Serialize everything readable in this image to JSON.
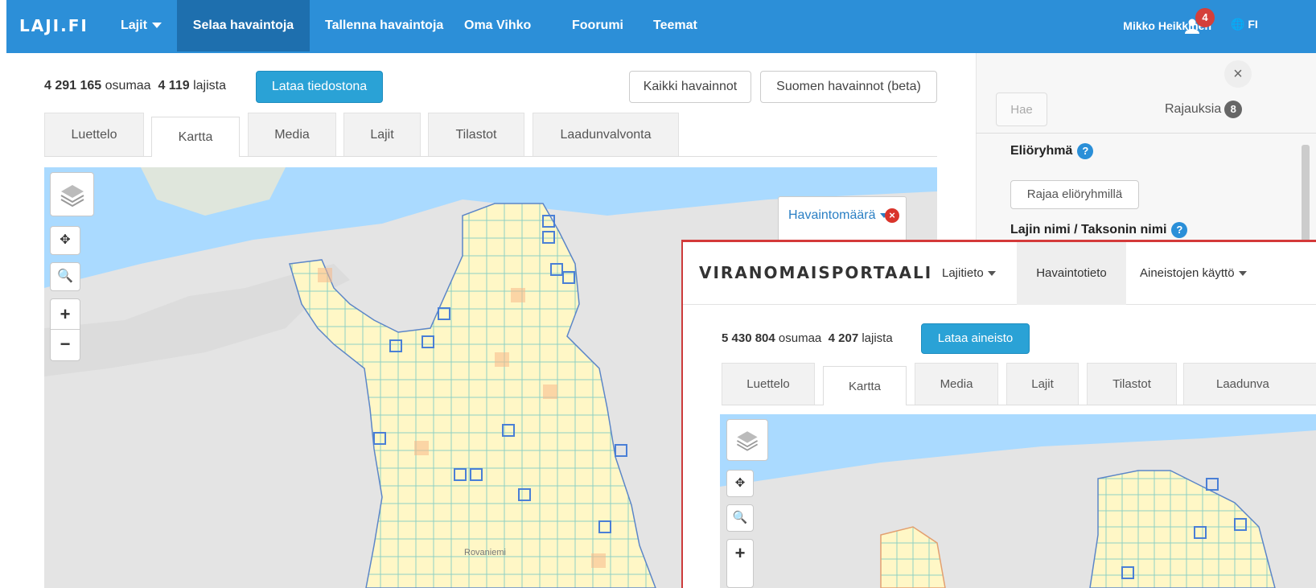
{
  "navbar": {
    "brand": "LAJI.FI",
    "items": [
      {
        "label": "Lajit"
      },
      {
        "label": "Selaa havaintoja"
      },
      {
        "label": "Tallenna havaintoja"
      },
      {
        "label": "Oma Vihko"
      },
      {
        "label": "Foorumi"
      },
      {
        "label": "Teemat"
      }
    ],
    "user": "Mikko Heikkinen",
    "notifications": "4",
    "language": "FI"
  },
  "results": {
    "count": "4 291 165",
    "count_label": "osumaa",
    "species": "4 119",
    "species_label": "lajista",
    "download_label": "Lataa tiedostona"
  },
  "scope_buttons": {
    "all": "Kaikki havainnot",
    "finland": "Suomen havainnot (beta)"
  },
  "tabs": [
    "Luettelo",
    "Kartta",
    "Media",
    "Lajit",
    "Tilastot",
    "Laadunvalvonta"
  ],
  "map": {
    "legend_label": "Havaintomäärä",
    "place_label": "Rovaniemi",
    "zoom_in": "+",
    "zoom_out": "−"
  },
  "filters": {
    "search_label": "Hae",
    "rajauksia_label": "Rajauksia",
    "rajauksia_count": "8",
    "group_label": "Eliöryhmä",
    "group_button": "Rajaa eliöryhmillä",
    "taxon_label": "Lajin nimi / Taksonin nimi"
  },
  "overlay": {
    "brand": "VIRANOMAISPORTAALI",
    "nav": [
      {
        "label": "Lajitieto"
      },
      {
        "label": "Havaintotieto"
      },
      {
        "label": "Aineistojen käyttö"
      }
    ],
    "count": "5 430 804",
    "count_label": "osumaa",
    "species": "4 207",
    "species_label": "lajista",
    "download_label": "Lataa aineisto",
    "tabs": [
      "Luettelo",
      "Kartta",
      "Media",
      "Lajit",
      "Tilastot",
      "Laadunva"
    ]
  }
}
